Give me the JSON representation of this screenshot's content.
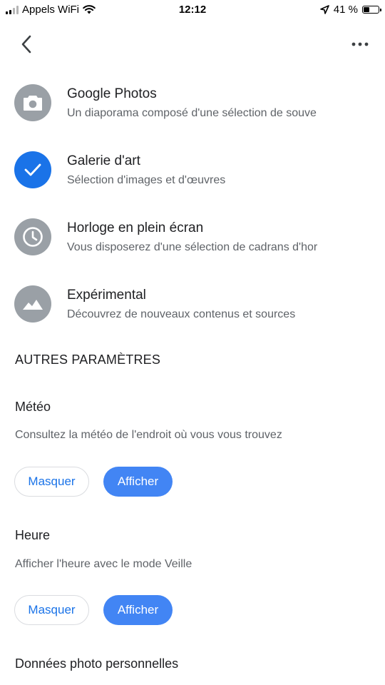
{
  "status_bar": {
    "carrier": "Appels WiFi",
    "time": "12:12",
    "battery": "41 %"
  },
  "top_bar": {
    "back_icon": "chevron-left-icon",
    "more_icon": "more-horizontal-icon"
  },
  "options": [
    {
      "title": "Google Photos",
      "subtitle": "Un diaporama composé d'une sélection de souve",
      "icon": "camera-icon",
      "selected": false
    },
    {
      "title": "Galerie d'art",
      "subtitle": "Sélection d'images et d'œuvres",
      "icon": "check-icon",
      "selected": true
    },
    {
      "title": "Horloge en plein écran",
      "subtitle": "Vous disposerez d'une sélection de cadrans d'hor",
      "icon": "clock-icon",
      "selected": false
    },
    {
      "title": "Expérimental",
      "subtitle": "Découvrez de nouveaux contenus et sources",
      "icon": "landscape-icon",
      "selected": false
    }
  ],
  "other_settings": {
    "header": "AUTRES PARAMÈTRES",
    "weather": {
      "title": "Météo",
      "description": "Consultez la météo de l'endroit où vous vous trouvez",
      "hide_label": "Masquer",
      "show_label": "Afficher"
    },
    "time": {
      "title": "Heure",
      "description": "Afficher l'heure avec le mode Veille",
      "hide_label": "Masquer",
      "show_label": "Afficher"
    },
    "personal_photo_data": {
      "title": "Données photo personnelles"
    }
  },
  "colors": {
    "accent": "#1a73e8",
    "filled_button": "#4285f4",
    "icon_gray": "#9aa0a6"
  }
}
